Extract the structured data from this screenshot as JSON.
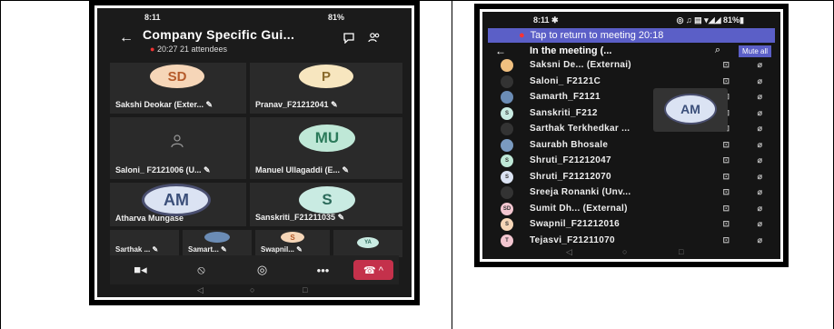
{
  "phone1": {
    "status": {
      "time": "8:11",
      "battery": "81%"
    },
    "header": {
      "back": "←",
      "title": "Company Specific Gui...",
      "rec_dot": "●",
      "subtitle": "20:27  21 attendees"
    },
    "tiles": [
      {
        "initials": "SD",
        "name": "Sakshi Deokar (Exter... ✎",
        "color": "#f6d6b8",
        "text_color": "#b55b2b"
      },
      {
        "initials": "P",
        "name": "Pranav_F21212041 ✎",
        "color": "#f7e6bf",
        "text_color": "#8a6a2b"
      },
      {
        "initials": "",
        "name": "Saloni_ F2121006 (U... ✎",
        "color": "",
        "text_color": ""
      },
      {
        "initials": "MU",
        "name": "Manuel Ullagaddi (E... ✎",
        "color": "#bfe8d7",
        "text_color": "#2b7a5a"
      },
      {
        "initials": "AM",
        "name": "Atharva Mungase",
        "color": "#dbe3f3",
        "text_color": "#3b4f7a"
      },
      {
        "initials": "S",
        "name": "Sanskriti_F21211035 ✎",
        "color": "#c9ebe2",
        "text_color": "#2b6a5a"
      }
    ],
    "small_tiles": [
      {
        "name": "Sarthak ... ✎"
      },
      {
        "name": "Samart... ✎"
      },
      {
        "initials": "S",
        "name": "Swapnil... ✎"
      },
      {
        "initials": "YA",
        "name": ""
      }
    ],
    "toolbar": {
      "camera": "■◂",
      "mic": "⦸",
      "speaker": "◎",
      "more": "•••",
      "end": "☎ ^"
    },
    "nav": {
      "back": "◁",
      "home": "○",
      "recent": "□"
    }
  },
  "phone2": {
    "status": {
      "time": "8:11 ✱",
      "icons": "◎ ♫ ▤ ▾◢◢ 81%▮"
    },
    "banner": {
      "rec": "●",
      "text": "Tap to return to meeting 20:18"
    },
    "header": {
      "back": "←",
      "title": "In the meeting (...",
      "search": "⌕",
      "mute_all": "Mute all"
    },
    "participants": [
      {
        "name": "Saksni De... (Externai)",
        "initials": "",
        "color": "#f0c080"
      },
      {
        "name": "Saloni_ F2121C",
        "initials": "",
        "color": "#333"
      },
      {
        "name": "Samarth_F2121",
        "initials": "",
        "color": "#6b8cb5"
      },
      {
        "name": "Sanskriti_F212",
        "initials": "S",
        "color": "#c9ebe2"
      },
      {
        "name": "Sarthak Terkhedkar ...",
        "initials": "",
        "color": "#333"
      },
      {
        "name": "Saurabh Bhosale",
        "initials": "",
        "color": "#7a9ac0"
      },
      {
        "name": "Shruti_F21212047",
        "initials": "S",
        "color": "#bfe8d7"
      },
      {
        "name": "Shruti_F21212070",
        "initials": "S",
        "color": "#dbe3f3"
      },
      {
        "name": "Sreeja Ronanki (Unv...",
        "initials": "",
        "color": "#333"
      },
      {
        "name": "Sumit Dh... (External)",
        "initials": "SD",
        "color": "#f3c6d0"
      },
      {
        "name": "Swapnil_F21212016",
        "initials": "S",
        "color": "#f6d6b8"
      },
      {
        "name": "Tejasvi_F21211070",
        "initials": "T",
        "color": "#f3c6d0"
      }
    ],
    "float_initials": "AM",
    "icon_cam": "⊡",
    "icon_mic": "⌀",
    "nav": {
      "back": "◁",
      "home": "○",
      "recent": "□"
    }
  }
}
